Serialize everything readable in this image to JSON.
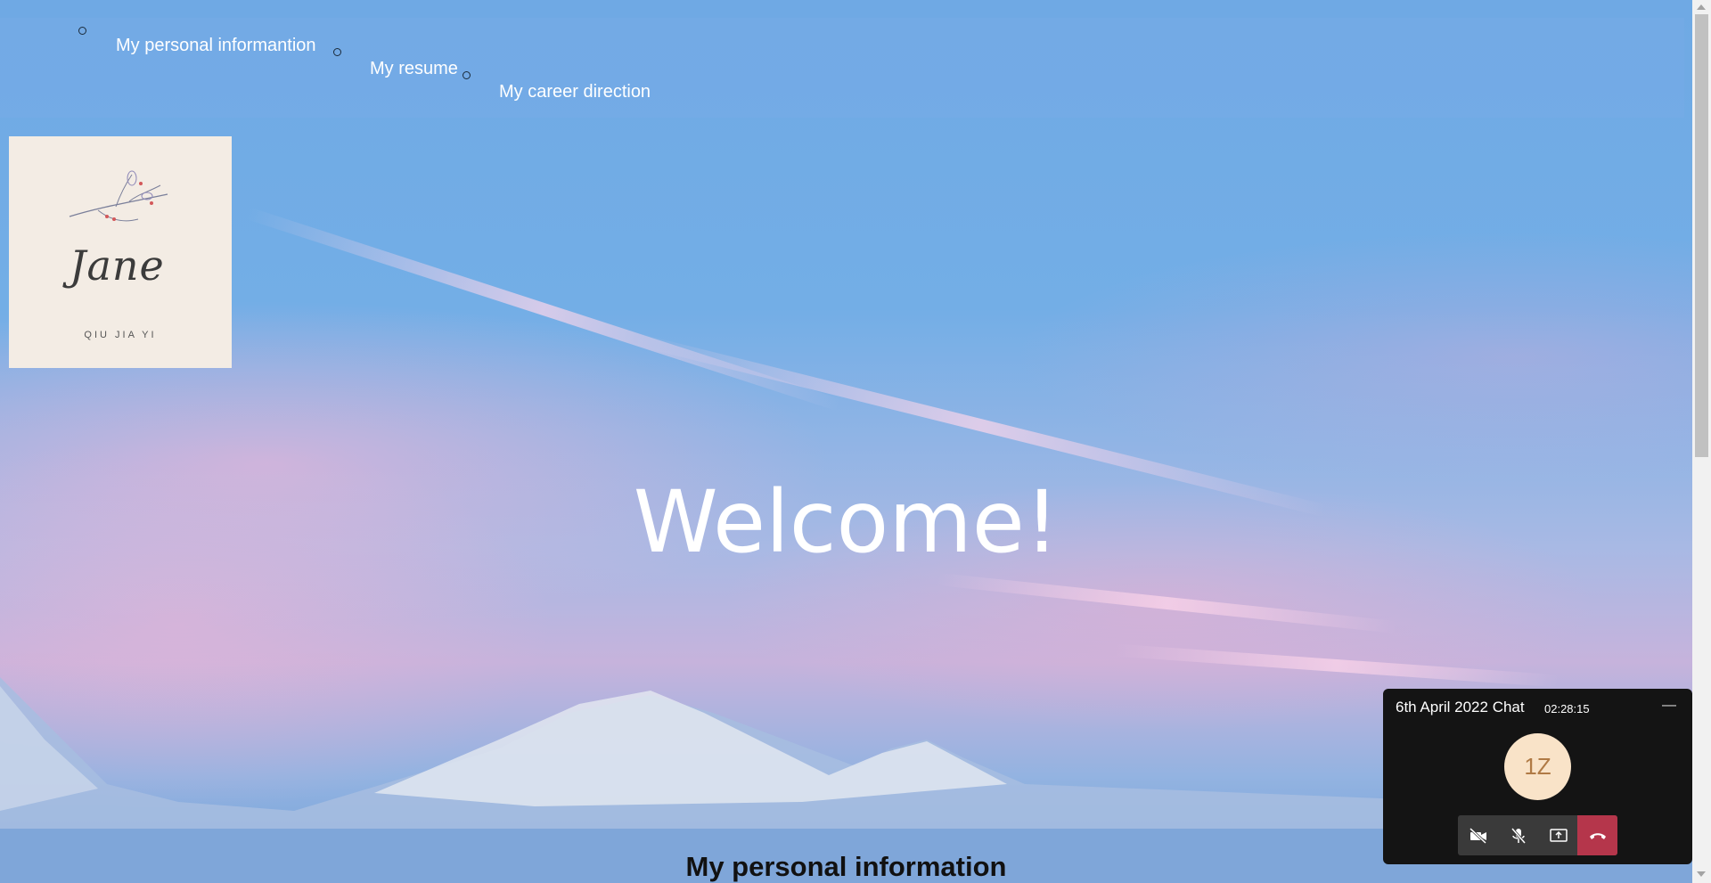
{
  "nav": {
    "links": [
      "My personal informantion",
      "My resume",
      "My career direction"
    ]
  },
  "logo": {
    "signature": "Jane",
    "subtitle": "QIU JIA YI"
  },
  "hero": {
    "welcome": "Welcome!"
  },
  "section": {
    "title": "My personal information"
  },
  "chat": {
    "title": "6th April 2022 Chat",
    "timer": "02:28:15",
    "minimize": "—",
    "avatar_initials": "1Z",
    "controls": [
      "video-off-icon",
      "mic-off-icon",
      "share-screen-icon",
      "end-call-icon"
    ],
    "end_call_color": "#b5364b"
  }
}
